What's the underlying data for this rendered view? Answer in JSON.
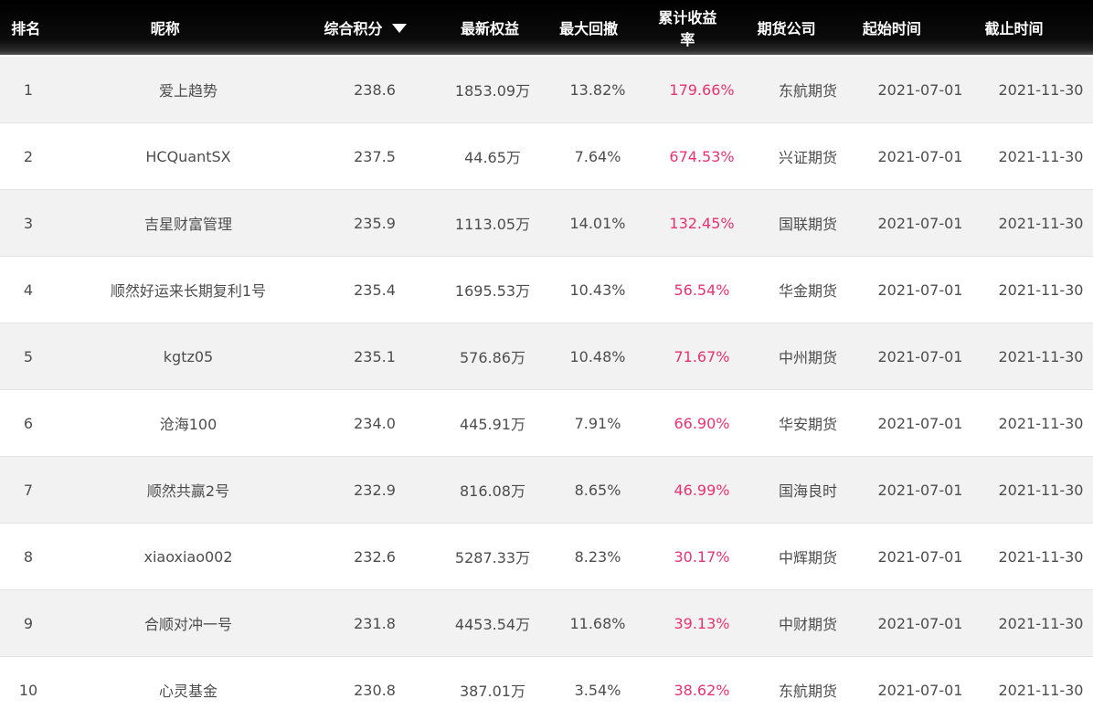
{
  "table": {
    "headers": {
      "rank": "排名",
      "nickname": "昵称",
      "score": "综合积分",
      "equity": "最新权益",
      "drawdown": "最大回撤",
      "return": "累计收益率",
      "broker": "期货公司",
      "start": "起始时间",
      "end": "截止时间"
    },
    "sort": {
      "column": "综合积分",
      "direction": "descending",
      "icon": "caret-down-icon"
    },
    "colors": {
      "header_bg": "#000000",
      "row_alt_bg": "#f2f2f2",
      "text": "#4d4d4d",
      "return_highlight": "#e8336f"
    },
    "rows": [
      {
        "rank": "1",
        "nickname": "爱上趋势",
        "score": "238.6",
        "equity": "1853.09万",
        "drawdown": "13.82%",
        "return": "179.66%",
        "broker": "东航期货",
        "start": "2021-07-01",
        "end": "2021-11-30"
      },
      {
        "rank": "2",
        "nickname": "HCQuantSX",
        "score": "237.5",
        "equity": "44.65万",
        "drawdown": "7.64%",
        "return": "674.53%",
        "broker": "兴证期货",
        "start": "2021-07-01",
        "end": "2021-11-30"
      },
      {
        "rank": "3",
        "nickname": "吉星财富管理",
        "score": "235.9",
        "equity": "1113.05万",
        "drawdown": "14.01%",
        "return": "132.45%",
        "broker": "国联期货",
        "start": "2021-07-01",
        "end": "2021-11-30"
      },
      {
        "rank": "4",
        "nickname": "顺然好运来长期复利1号",
        "score": "235.4",
        "equity": "1695.53万",
        "drawdown": "10.43%",
        "return": "56.54%",
        "broker": "华金期货",
        "start": "2021-07-01",
        "end": "2021-11-30"
      },
      {
        "rank": "5",
        "nickname": "kgtz05",
        "score": "235.1",
        "equity": "576.86万",
        "drawdown": "10.48%",
        "return": "71.67%",
        "broker": "中州期货",
        "start": "2021-07-01",
        "end": "2021-11-30"
      },
      {
        "rank": "6",
        "nickname": "沧海100",
        "score": "234.0",
        "equity": "445.91万",
        "drawdown": "7.91%",
        "return": "66.90%",
        "broker": "华安期货",
        "start": "2021-07-01",
        "end": "2021-11-30"
      },
      {
        "rank": "7",
        "nickname": "顺然共赢2号",
        "score": "232.9",
        "equity": "816.08万",
        "drawdown": "8.65%",
        "return": "46.99%",
        "broker": "国海良时",
        "start": "2021-07-01",
        "end": "2021-11-30"
      },
      {
        "rank": "8",
        "nickname": "xiaoxiao002",
        "score": "232.6",
        "equity": "5287.33万",
        "drawdown": "8.23%",
        "return": "30.17%",
        "broker": "中辉期货",
        "start": "2021-07-01",
        "end": "2021-11-30"
      },
      {
        "rank": "9",
        "nickname": "合顺对冲一号",
        "score": "231.8",
        "equity": "4453.54万",
        "drawdown": "11.68%",
        "return": "39.13%",
        "broker": "中财期货",
        "start": "2021-07-01",
        "end": "2021-11-30"
      },
      {
        "rank": "10",
        "nickname": "心灵基金",
        "score": "230.8",
        "equity": "387.01万",
        "drawdown": "3.54%",
        "return": "38.62%",
        "broker": "东航期货",
        "start": "2021-07-01",
        "end": "2021-11-30"
      }
    ]
  }
}
